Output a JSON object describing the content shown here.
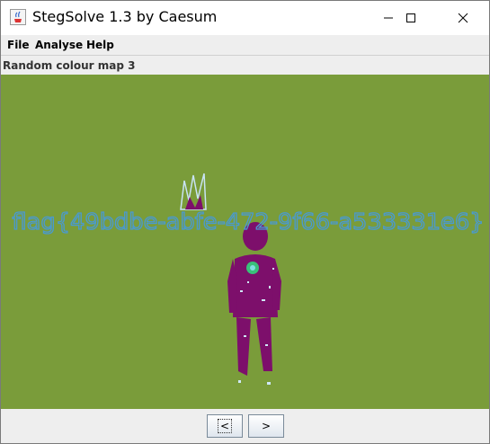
{
  "window": {
    "title": "StegSolve 1.3 by Caesum",
    "minimize_icon": "minimize-icon",
    "maximize_icon": "maximize-icon",
    "close_icon": "close-icon"
  },
  "menu": {
    "items": [
      {
        "label": "File"
      },
      {
        "label": "Analyse"
      },
      {
        "label": "Help"
      }
    ]
  },
  "panel": {
    "label": "Random colour map 3"
  },
  "image": {
    "flag_text": "flag{49bdbe-abfe-472-9f66-a533331e6}",
    "background_color": "#7a9c3a",
    "figure_color": "#7d0f6b",
    "text_color": "#4a9ad0"
  },
  "nav": {
    "prev_label": "<",
    "next_label": ">"
  }
}
